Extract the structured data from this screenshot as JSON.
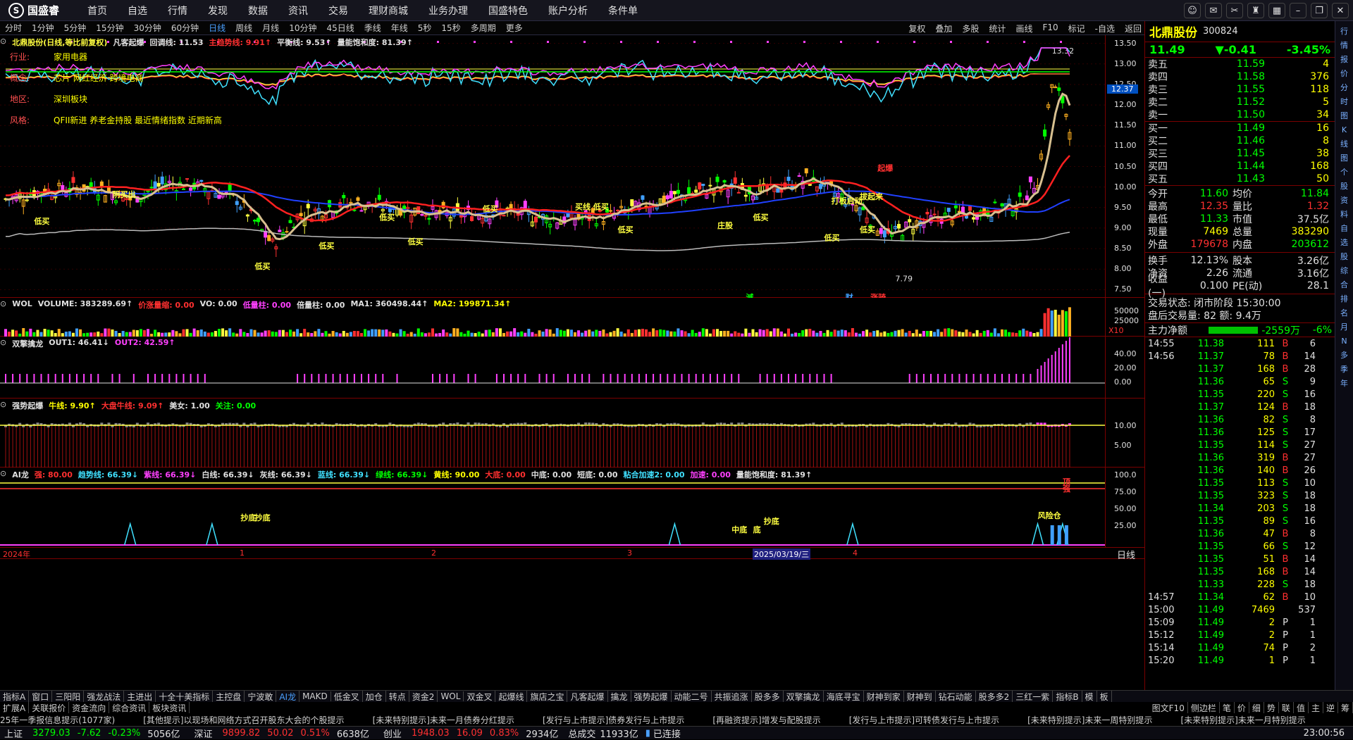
{
  "app": {
    "logo": "国盛睿",
    "menu": [
      "首页",
      "自选",
      "行情",
      "发现",
      "数据",
      "资讯",
      "交易",
      "理财商城",
      "业务办理",
      "国盛特色",
      "账户分析",
      "条件单"
    ]
  },
  "window_icons": [
    "chat-icon",
    "envelope-icon",
    "tools-icon",
    "shirt-icon",
    "grid-icon",
    "minimize-icon",
    "maximize-icon",
    "close-icon"
  ],
  "period_bar": {
    "items": [
      "分时",
      "1分钟",
      "5分钟",
      "15分钟",
      "30分钟",
      "60分钟",
      "日线",
      "周线",
      "月线",
      "10分钟",
      "45日线",
      "季线",
      "年线",
      "5秒",
      "15秒",
      "多周期",
      "更多"
    ],
    "active": "日线",
    "tools": [
      "复权",
      "叠加",
      "多股",
      "统计",
      "画线",
      "F10",
      "标记",
      "-自选",
      "返回"
    ]
  },
  "main_header": {
    "title": "北鼎股份(日线,等比前复权)",
    "indicator": "凡客起爆",
    "items": [
      {
        "t": "回调线: 11.53",
        "c": "#e0e0e0"
      },
      {
        "t": "主趋势线: 9.91↑",
        "c": "#ff3030"
      },
      {
        "t": "平衡线: 9.53↑",
        "c": "#e0e0e0"
      },
      {
        "t": "量能饱和度: 81.39↑",
        "c": "#e0e0e0"
      }
    ]
  },
  "info": [
    {
      "k": "行业:",
      "v": "家用电器"
    },
    {
      "k": "概念:",
      "v": "芯片 网红经济 跨境电商"
    },
    {
      "k": "地区:",
      "v": "深圳板块"
    },
    {
      "k": "风格:",
      "v": "QFII新进 养老金持股 最近情绪指数 近期新高"
    }
  ],
  "main_axis": [
    "13.50",
    "13.00",
    "12.50",
    "12.00",
    "11.50",
    "11.00",
    "10.50",
    "10.00",
    "9.50",
    "9.00",
    "8.50",
    "8.00",
    "7.50"
  ],
  "price_tag": "12.37",
  "high_label": "13.32",
  "low_label": "7.79",
  "signals": [
    "低买",
    "阴买出",
    "买线 低买",
    "低买",
    "低买",
    "低买",
    "庄股",
    "低买",
    "低买",
    "低买",
    "低买",
    "低买",
    "低买",
    "打板启动",
    "拔起来",
    "起爆",
    "減",
    "财",
    "涨骑"
  ],
  "vol_header": {
    "name": "WOL",
    "items": [
      {
        "t": "VOLUME: 383289.69↑",
        "c": "#e0e0e0"
      },
      {
        "t": "价涨量缩: 0.00",
        "c": "#ff3030"
      },
      {
        "t": "VO: 0.00",
        "c": "#e0e0e0"
      },
      {
        "t": "低量柱: 0.00",
        "c": "#ff40ff"
      },
      {
        "t": "倍量柱: 0.00",
        "c": "#e0e0e0"
      },
      {
        "t": "MA1: 360498.44↑",
        "c": "#e0e0e0"
      },
      {
        "t": "MA2: 199871.34↑",
        "c": "#ffff00"
      }
    ]
  },
  "vol_axis": [
    "50000",
    "25000"
  ],
  "vol_unit": "X10",
  "p3_header": {
    "name": "双擎擒龙",
    "items": [
      {
        "t": "OUT1: 46.41↓",
        "c": "#e0e0e0"
      },
      {
        "t": "OUT2: 42.59↑",
        "c": "#ff40ff"
      }
    ]
  },
  "p3_axis": [
    "40.00",
    "20.00",
    "0.00"
  ],
  "p4_header": {
    "name": "强势起爆",
    "items": [
      {
        "t": "牛线: 9.90↑",
        "c": "#ffff00"
      },
      {
        "t": "大盘牛线: 9.09↑",
        "c": "#ff3030"
      },
      {
        "t": "美女: 1.00",
        "c": "#e0e0e0"
      },
      {
        "t": "关注: 0.00",
        "c": "#00ff00"
      }
    ]
  },
  "p4_axis": [
    "10.00",
    "5.00"
  ],
  "p5_header": {
    "name": "AI龙",
    "items": [
      {
        "t": "强: 80.00",
        "c": "#ff3030"
      },
      {
        "t": "趋势线: 66.39↓",
        "c": "#40e0ff"
      },
      {
        "t": "紫线: 66.39↓",
        "c": "#ff40ff"
      },
      {
        "t": "白线: 66.39↓",
        "c": "#e0e0e0"
      },
      {
        "t": "灰线: 66.39↓",
        "c": "#e0e0e0"
      },
      {
        "t": "蓝线: 66.39↓",
        "c": "#40e0ff"
      },
      {
        "t": "绿线: 66.39↓",
        "c": "#00ff00"
      },
      {
        "t": "黄线: 90.00",
        "c": "#ffff00"
      },
      {
        "t": "大底: 0.00",
        "c": "#ff3030"
      },
      {
        "t": "中底: 0.00",
        "c": "#e0e0e0"
      },
      {
        "t": "短底: 0.00",
        "c": "#e0e0e0"
      },
      {
        "t": "粘合加速2: 0.00",
        "c": "#40e0ff"
      },
      {
        "t": "加速: 0.00",
        "c": "#ff40ff"
      },
      {
        "t": "量能饱和度: 81.39↑",
        "c": "#e0e0e0"
      }
    ]
  },
  "p5_axis": [
    "100.0",
    "75.00",
    "50.00",
    "25.00"
  ],
  "p5_labels": [
    "抄底",
    "抄底",
    "中底",
    "底",
    "抄底",
    "风险仓",
    "顶",
    "强"
  ],
  "date_axis": [
    "2024年",
    "1",
    "2",
    "3",
    "4"
  ],
  "date_marker": "2025/03/19/三",
  "date_right": "日线",
  "quote": {
    "name": "北鼎股份",
    "code": "300824",
    "price": "11.49",
    "change": "▼-0.41",
    "pct": "-3.45%",
    "asks": [
      {
        "l": "卖五",
        "p": "11.59",
        "v": "4"
      },
      {
        "l": "卖四",
        "p": "11.58",
        "v": "376"
      },
      {
        "l": "卖三",
        "p": "11.55",
        "v": "118"
      },
      {
        "l": "卖二",
        "p": "11.52",
        "v": "5"
      },
      {
        "l": "卖一",
        "p": "11.50",
        "v": "34"
      }
    ],
    "bids": [
      {
        "l": "买一",
        "p": "11.49",
        "v": "16"
      },
      {
        "l": "买二",
        "p": "11.46",
        "v": "8"
      },
      {
        "l": "买三",
        "p": "11.45",
        "v": "38"
      },
      {
        "l": "买四",
        "p": "11.44",
        "v": "168"
      },
      {
        "l": "买五",
        "p": "11.43",
        "v": "50"
      }
    ],
    "stats": [
      {
        "l1": "今开",
        "v1": "11.60",
        "c1": "#00ff00",
        "l2": "均价",
        "v2": "11.84",
        "c2": "#00ff00"
      },
      {
        "l1": "最高",
        "v1": "12.35",
        "c1": "#ff3030",
        "l2": "量比",
        "v2": "1.32",
        "c2": "#ff3030"
      },
      {
        "l1": "最低",
        "v1": "11.33",
        "c1": "#00ff00",
        "l2": "市值",
        "v2": "37.5亿",
        "c2": "#e0e0e0"
      },
      {
        "l1": "现量",
        "v1": "7469",
        "c1": "#ffff00",
        "l2": "总量",
        "v2": "383290",
        "c2": "#ffff00"
      },
      {
        "l1": "外盘",
        "v1": "179678",
        "c1": "#ff3030",
        "l2": "内盘",
        "v2": "203612",
        "c2": "#00ff00"
      }
    ],
    "stats2": [
      {
        "l1": "换手",
        "v1": "12.13%",
        "c1": "#e0e0e0",
        "l2": "股本",
        "v2": "3.26亿",
        "c2": "#e0e0e0"
      },
      {
        "l1": "净资",
        "v1": "2.26",
        "c1": "#e0e0e0",
        "l2": "流通",
        "v2": "3.16亿",
        "c2": "#e0e0e0"
      },
      {
        "l1": "收益(一)",
        "v1": "0.100",
        "c1": "#e0e0e0",
        "l2": "PE(动)",
        "v2": "28.1",
        "c2": "#e0e0e0"
      }
    ],
    "state1": "交易状态: 闭市阶段 15:30:00",
    "state2": "盘后交易量: 82  额: 9.4万",
    "zl": {
      "label": "主力净额",
      "val": "-2559万",
      "pct": "-6%"
    }
  },
  "ticks": [
    {
      "t": "14:55",
      "p": "11.38",
      "q": "111",
      "d": "B",
      "n": "6"
    },
    {
      "t": "14:56",
      "p": "11.37",
      "q": "78",
      "d": "B",
      "n": "14"
    },
    {
      "t": "",
      "p": "11.37",
      "q": "168",
      "d": "B",
      "n": "28"
    },
    {
      "t": "",
      "p": "11.36",
      "q": "65",
      "d": "S",
      "n": "9"
    },
    {
      "t": "",
      "p": "11.35",
      "q": "220",
      "d": "S",
      "n": "16"
    },
    {
      "t": "",
      "p": "11.37",
      "q": "124",
      "d": "B",
      "n": "18"
    },
    {
      "t": "",
      "p": "11.36",
      "q": "82",
      "d": "S",
      "n": "8"
    },
    {
      "t": "",
      "p": "11.36",
      "q": "125",
      "d": "S",
      "n": "17"
    },
    {
      "t": "",
      "p": "11.35",
      "q": "114",
      "d": "S",
      "n": "27"
    },
    {
      "t": "",
      "p": "11.36",
      "q": "319",
      "d": "B",
      "n": "27"
    },
    {
      "t": "",
      "p": "11.36",
      "q": "140",
      "d": "B",
      "n": "26"
    },
    {
      "t": "",
      "p": "11.35",
      "q": "113",
      "d": "S",
      "n": "10"
    },
    {
      "t": "",
      "p": "11.35",
      "q": "323",
      "d": "S",
      "n": "18"
    },
    {
      "t": "",
      "p": "11.34",
      "q": "203",
      "d": "S",
      "n": "18"
    },
    {
      "t": "",
      "p": "11.35",
      "q": "89",
      "d": "S",
      "n": "16"
    },
    {
      "t": "",
      "p": "11.36",
      "q": "47",
      "d": "B",
      "n": "8"
    },
    {
      "t": "",
      "p": "11.35",
      "q": "66",
      "d": "S",
      "n": "12"
    },
    {
      "t": "",
      "p": "11.35",
      "q": "51",
      "d": "B",
      "n": "14"
    },
    {
      "t": "",
      "p": "11.35",
      "q": "168",
      "d": "B",
      "n": "14"
    },
    {
      "t": "",
      "p": "11.33",
      "q": "228",
      "d": "S",
      "n": "18"
    },
    {
      "t": "14:57",
      "p": "11.34",
      "q": "62",
      "d": "B",
      "n": "10"
    },
    {
      "t": "15:00",
      "p": "11.49",
      "q": "7469",
      "d": "",
      "n": "537"
    },
    {
      "t": "15:09",
      "p": "11.49",
      "q": "2",
      "d": "P",
      "n": "1"
    },
    {
      "t": "15:12",
      "p": "11.49",
      "q": "2",
      "d": "P",
      "n": "1"
    },
    {
      "t": "15:14",
      "p": "11.49",
      "q": "74",
      "d": "P",
      "n": "2"
    },
    {
      "t": "15:20",
      "p": "11.49",
      "q": "1",
      "d": "P",
      "n": "1"
    }
  ],
  "sidebar": [
    "行",
    "情",
    "报",
    "价",
    "分",
    "时",
    "图",
    "K",
    "线",
    "图",
    "个",
    "股",
    "资",
    "料",
    "自",
    "选",
    "股",
    "综",
    "合",
    "排",
    "名",
    "月",
    "N",
    "多",
    "季",
    "年"
  ],
  "tabs1": [
    "指标A",
    "窗口",
    "三阳阳",
    "强龙战法",
    "主进出",
    "十全十美指标",
    "主控盘",
    "宁波敢",
    "AI龙",
    "MAKD",
    "低金叉",
    "加仓",
    "转点",
    "资金2",
    "WOL",
    "双金叉",
    "起爆线",
    "旗店之宝",
    "凡客起爆",
    "擒龙",
    "强势起爆",
    "动能二号",
    "共振追涨",
    "股多多",
    "双擎擒龙",
    "海底寻宝",
    "财神到家",
    "财神到",
    "钻石动能",
    "股多多2",
    "三红一紫",
    "指标B",
    "模",
    "板"
  ],
  "tabs1_active": "AI龙",
  "tabs2": [
    "扩展A",
    "关联报价",
    "资金流向",
    "综合资讯",
    "板块资讯"
  ],
  "tabs2_right": [
    "图文F10",
    "侧边栏",
    "笔",
    "价",
    "细",
    "势",
    "联",
    "值",
    "主",
    "逆",
    "筹"
  ],
  "ticker": [
    "25年一季报信息提示(1077家)",
    "[其他提示]以现场和网络方式召开股东大会的个股提示",
    "[未来特别提示]未来一月债券分红提示",
    "[发行与上市提示]债券发行与上市提示",
    "[再融资提示]增发与配股提示",
    "[发行与上市提示]可转债发行与上市提示",
    "[未来特别提示]未来一周特别提示",
    "[未来特别提示]未来一月特别提示"
  ],
  "status": {
    "sh": {
      "n": "上证",
      "p": "3279.03",
      "c": "-7.62",
      "pct": "-0.23%",
      "a": "5056亿"
    },
    "sz": {
      "n": "深证",
      "p": "9899.82",
      "c": "50.02",
      "pct": "0.51%",
      "a": "6638亿"
    },
    "cy": {
      "n": "创业",
      "p": "1948.03",
      "c": "16.09",
      "pct": "0.83%",
      "a": "2934亿"
    },
    "total_label": "总成交",
    "total": "11933亿",
    "conn": "已连接",
    "time": "23:00:56"
  },
  "colors": {
    "up": "#ff3030",
    "down": "#00ff00",
    "flat": "#e0e0e0",
    "highlight": "#ffff00",
    "accent": "#4aa0ff"
  }
}
